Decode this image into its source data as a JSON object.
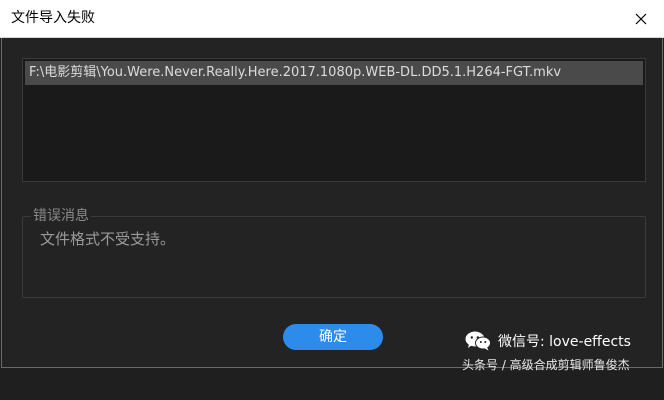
{
  "window": {
    "title": "文件导入失败"
  },
  "files": [
    {
      "path": "F:\\电影剪辑\\You.Were.Never.Really.Here.2017.1080p.WEB-DL.DD5.1.H264-FGT.mkv"
    }
  ],
  "error": {
    "legend": "错误消息",
    "message": "文件格式不受支持。"
  },
  "buttons": {
    "ok_label": "确定"
  },
  "watermark": {
    "wechat_label": "微信号: love-effects",
    "toutiao_label": "头条号 / 高级合成剪辑师鲁俊杰"
  },
  "colors": {
    "accent": "#2d8ceb",
    "dialog_bg": "#232323",
    "selected_row": "#4a4a4a"
  }
}
